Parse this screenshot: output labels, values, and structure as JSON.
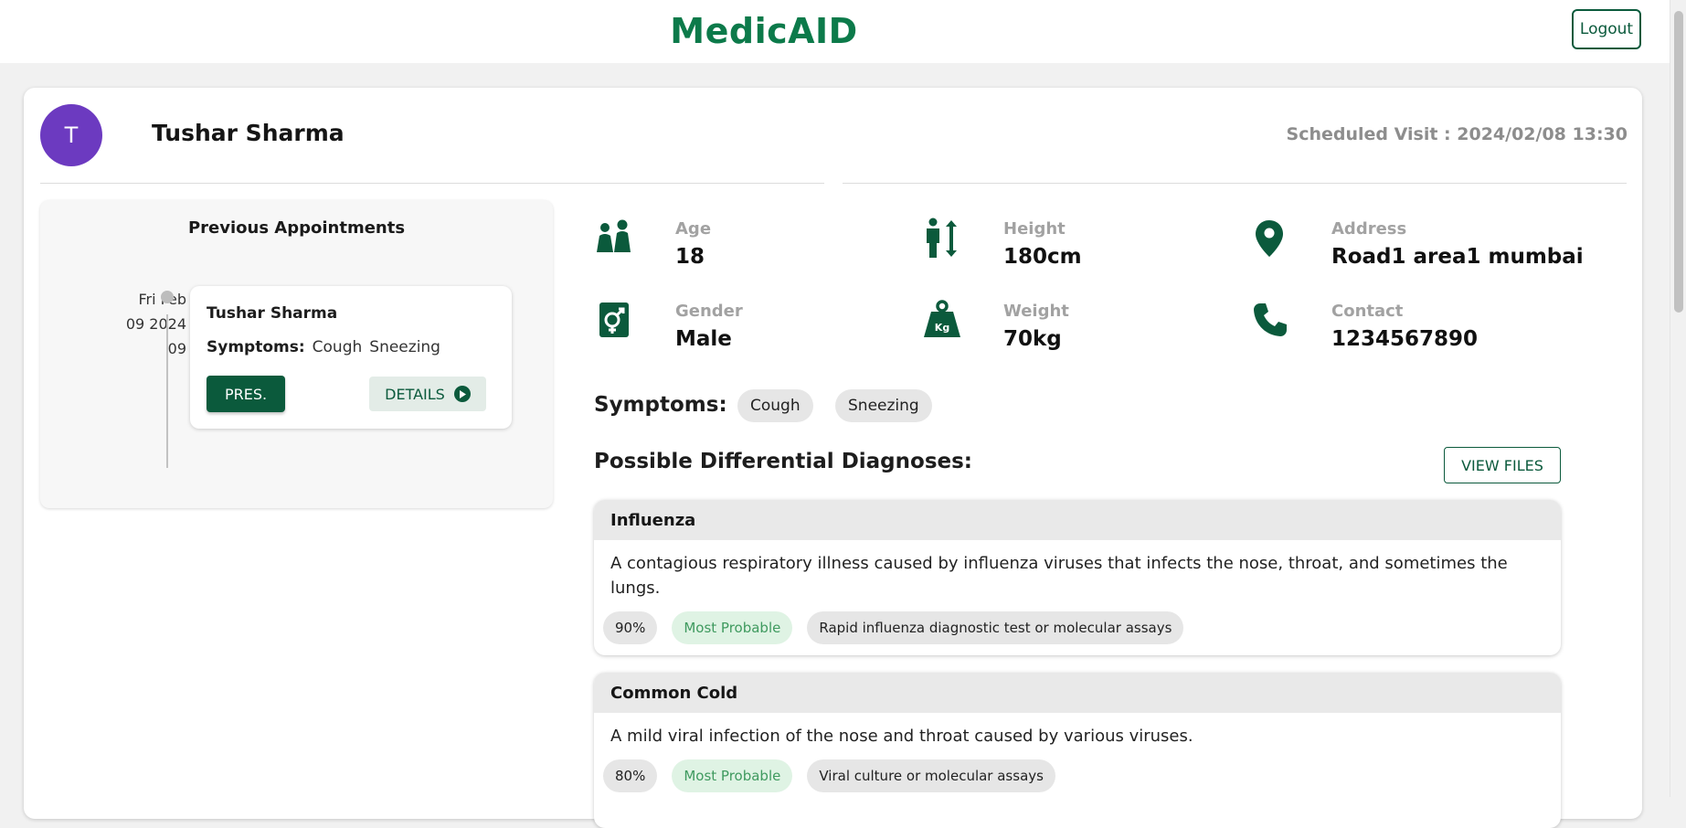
{
  "header": {
    "brand": "MedicAID",
    "logout_label": "Logout"
  },
  "patient": {
    "avatar_initial": "T",
    "name": "Tushar Sharma",
    "scheduled_visit": "Scheduled Visit : 2024/02/08 13:30"
  },
  "previous_appointments": {
    "title": "Previous Appointments",
    "items": [
      {
        "date_line1": "Fri Feb",
        "date_line2": "09 2024",
        "date_line3": "09",
        "name": "Tushar Sharma",
        "symptoms_label": "Symptoms:",
        "symptoms": [
          "Cough",
          "Sneezing"
        ],
        "pres_label": "PRES.",
        "details_label": "DETAILS"
      }
    ]
  },
  "stats": {
    "age": {
      "label": "Age",
      "value": "18",
      "icon": "people-icon"
    },
    "height": {
      "label": "Height",
      "value": "180cm",
      "icon": "height-icon"
    },
    "address": {
      "label": "Address",
      "value": "Road1 area1 mumbai",
      "icon": "location-pin-icon"
    },
    "gender": {
      "label": "Gender",
      "value": "Male",
      "icon": "gender-icon"
    },
    "weight": {
      "label": "Weight",
      "value": "70kg",
      "icon": "weight-icon",
      "icon_text": "Kg"
    },
    "contact": {
      "label": "Contact",
      "value": "1234567890",
      "icon": "phone-icon"
    }
  },
  "symptoms": {
    "title": "Symptoms:",
    "items": [
      "Cough",
      "Sneezing"
    ]
  },
  "diagnoses": {
    "title": "Possible Differential Diagnoses:",
    "view_files_label": "VIEW FILES",
    "items": [
      {
        "name": "Influenza",
        "description": "A contagious respiratory illness caused by influenza viruses that infects the nose, throat, and sometimes the lungs.",
        "probability": "90%",
        "likelihood": "Most Probable",
        "test": "Rapid influenza diagnostic test or molecular assays"
      },
      {
        "name": "Common Cold",
        "description": "A mild viral infection of the nose and throat caused by various viruses.",
        "probability": "80%",
        "likelihood": "Most Probable",
        "test": "Viral culture or molecular assays"
      }
    ]
  },
  "colors": {
    "brand_green": "#0c7a4a",
    "dark_green": "#0b5a3c",
    "avatar_purple": "#6c3ac0",
    "probable_text": "#3f9a5f",
    "probable_bg": "#dff3e4"
  }
}
